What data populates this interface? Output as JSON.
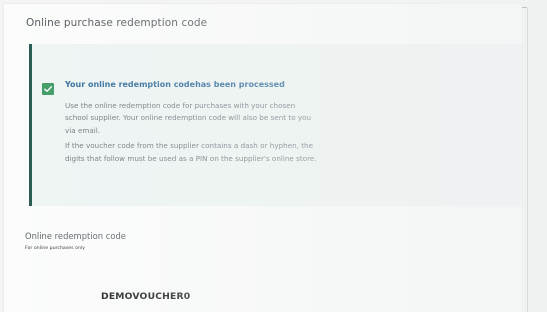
{
  "card": {
    "title": "Online purchase redemption code"
  },
  "notice": {
    "icon": "checkbox-checked-icon",
    "heading": "Your online redemption codehas been processed",
    "body_lines": [
      "Use the online redemption code for purchases with your chosen",
      "school supplier. Your online redemption code will also be sent to you",
      "via email.",
      "If the voucher code from the supplier contains a dash or hyphen, the",
      "digits that follow must be used as a PIN on the supplier's online store."
    ]
  },
  "redemption": {
    "label": "Online redemption code",
    "subtext": "For online purchases only",
    "code": "DEMOVOUCHER0"
  },
  "colors": {
    "accent_bar": "#25584f",
    "check_icon": "#3c9a63",
    "heading_text": "#2e6a9a",
    "notice_background": "#eef5f3"
  }
}
